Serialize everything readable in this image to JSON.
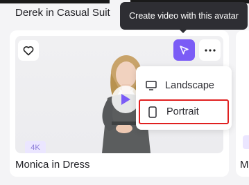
{
  "previous_card": {
    "title": "Derek in Casual Suit"
  },
  "tooltip": {
    "text": "Create video with this avatar"
  },
  "card": {
    "title": "Monica in Dress",
    "quality_badge": "4K",
    "icons": {
      "favorite": "heart-icon",
      "create_video": "cursor-icon",
      "more": "more-dots-icon",
      "play": "play-icon"
    }
  },
  "dropdown": {
    "items": [
      {
        "label": "Landscape",
        "icon": "monitor-icon"
      },
      {
        "label": "Portrait",
        "icon": "phone-icon"
      }
    ]
  },
  "next_card": {
    "title": "Mo"
  },
  "colors": {
    "accent": "#7b5cf6",
    "tooltip_bg": "#2e2e33",
    "highlight_border": "#e02020",
    "badge_bg": "#ebe6ff"
  }
}
